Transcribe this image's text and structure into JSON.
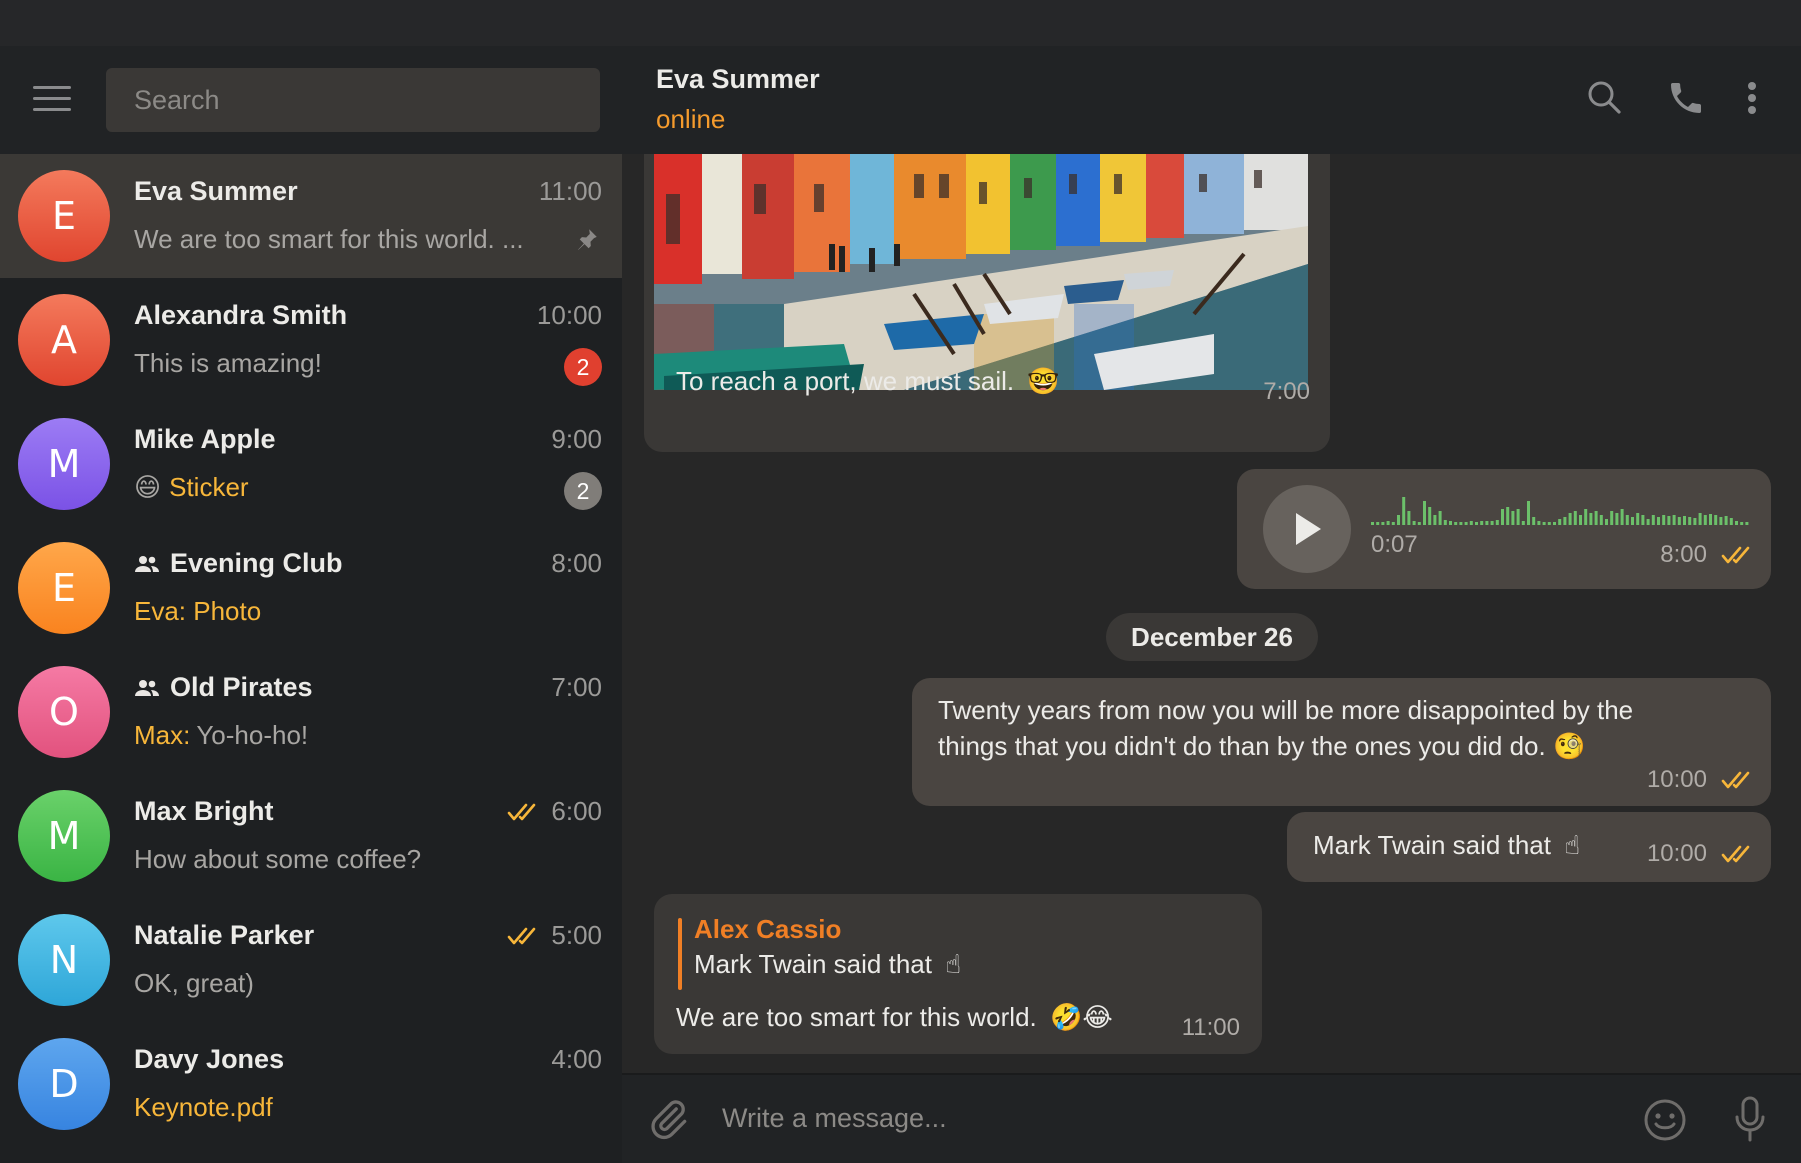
{
  "search": {
    "placeholder": "Search"
  },
  "chats": [
    {
      "initial": "E",
      "name": "Eva Summer",
      "time": "11:00",
      "preview": "We are too smart for this world. ...",
      "pinned": true,
      "color_top": "#f47a5c",
      "color_bottom": "#e0452f"
    },
    {
      "initial": "A",
      "name": "Alexandra Smith",
      "time": "10:00",
      "preview": "This is amazing!",
      "unread": "2",
      "color_top": "#f47a5c",
      "color_bottom": "#e0452f"
    },
    {
      "initial": "M",
      "name": "Mike Apple",
      "time": "9:00",
      "preview_emoji": "😄",
      "preview": "Sticker",
      "unread": "2",
      "color_top": "#9c7cf4",
      "color_bottom": "#7b52e6"
    },
    {
      "initial": "E",
      "name": "Evening Club",
      "time": "8:00",
      "preview": "Eva: Photo",
      "group": true,
      "color_top": "#ffa74a",
      "color_bottom": "#f9831f"
    },
    {
      "initial": "O",
      "name": "Old Pirates",
      "time": "7:00",
      "preview_sender": "Max:",
      "preview": "Yo-ho-ho!",
      "group": true,
      "color_top": "#f57aa4",
      "color_bottom": "#e2527e"
    },
    {
      "initial": "M",
      "name": "Max Bright",
      "time": "6:00",
      "preview": "How about some coffee?",
      "read": true,
      "color_top": "#6ad16a",
      "color_bottom": "#3ab444"
    },
    {
      "initial": "N",
      "name": "Natalie Parker",
      "time": "5:00",
      "preview": "OK, great)",
      "read": true,
      "color_top": "#5ec8ec",
      "color_bottom": "#2ea6d8"
    },
    {
      "initial": "D",
      "name": "Davy Jones",
      "time": "4:00",
      "preview": "Keynote.pdf",
      "color_top": "#5ea6ee",
      "color_bottom": "#3784e0"
    }
  ],
  "header": {
    "name": "Eva Summer",
    "status": "online"
  },
  "messages": {
    "photo_caption": "To reach a port, we must sail.",
    "photo_caption_emoji": "🤓",
    "photo_time": "7:00",
    "voice_duration": "0:07",
    "voice_time": "8:00",
    "date_separator": "December 26",
    "long_line1": "Twenty years from now you will be more disappointed by the",
    "long_line2": "things that you didn't do than by the ones you did do.",
    "long_emoji": "🧐",
    "long_time": "10:00",
    "short_text": "Mark Twain said that",
    "short_emoji": "☝",
    "short_time": "10:00",
    "reply_author": "Alex Cassio",
    "reply_quote": "Mark Twain said that",
    "reply_quote_emoji": "☝",
    "reply_text": "We are too smart for this world.",
    "reply_emoji": "🤣😂",
    "reply_time": "11:00"
  },
  "composer": {
    "placeholder": "Write a message..."
  },
  "colors": {
    "accent": "#f59b2d",
    "checks": "#f7b63a",
    "reply_author": "#f07f25"
  },
  "icons": [
    "menu-icon",
    "search-icon",
    "phone-icon",
    "more-vertical-icon",
    "pin-icon",
    "group-icon",
    "double-check-icon",
    "play-icon",
    "attach-icon",
    "emoji-icon",
    "microphone-icon"
  ]
}
